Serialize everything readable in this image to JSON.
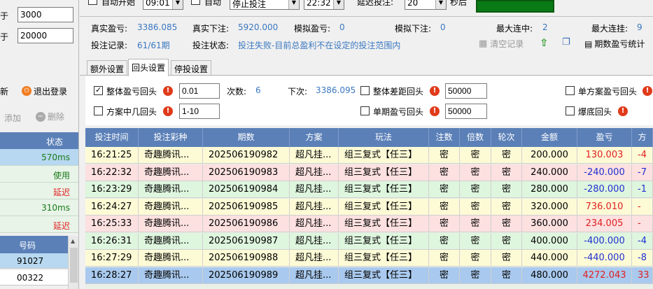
{
  "left": {
    "row1": {
      "label": "大于",
      "value": "3000"
    },
    "row2": {
      "label": "大于",
      "value": "20000"
    },
    "new_label": "新",
    "logout_label": "退出登录",
    "add_label": "添加",
    "delete_label": "删除",
    "status_header": "状态",
    "status_rows": [
      {
        "text": "570ms",
        "color": "#1a7a1a",
        "bg": "#b7d8f0"
      },
      {
        "text": "使用",
        "color": "#1a7a1a",
        "bg": "#e8f4e8"
      },
      {
        "text": "延迟",
        "color": "#e02020",
        "bg": "#e8f4e8"
      },
      {
        "text": "310ms",
        "color": "#1a7a1a",
        "bg": "#e8f4e8"
      },
      {
        "text": "延迟",
        "color": "#e02020",
        "bg": "#e8f4e8"
      }
    ],
    "number_header": "号码",
    "number_rows": [
      {
        "text": "91027",
        "bg": "#b7d8f0"
      },
      {
        "text": "00322",
        "bg": "#ffffff"
      }
    ]
  },
  "topbar": {
    "auto_start_label": "自动开始",
    "start_time": "09:01",
    "auto_label": "自动",
    "mode_select": "停止投注",
    "end_time": "22:32",
    "delay_label": "延迟投注:",
    "delay_value": "20",
    "seconds_label": "秒后"
  },
  "info": {
    "real_profit_label": "真实盈亏:",
    "real_profit_value": "3386.085",
    "real_bet_label": "真实下注:",
    "real_bet_value": "5920.000",
    "sim_profit_label": "模拟盈亏:",
    "sim_profit_value": "0",
    "sim_bet_label": "模拟下注:",
    "sim_bet_value": "0",
    "max_win_label": "最大连中:",
    "max_win_value": "2",
    "max_loss_label": "最大连挂:",
    "max_loss_value": "9",
    "record_label": "投注记录:",
    "record_value": "61/61期",
    "status_label": "投注状态:",
    "status_value": "投注失败-目前总盈利不在设定的投注范围内",
    "clear_label": "清空记录",
    "stats_label": "期数盈亏统计"
  },
  "tabs": [
    {
      "label": "额外设置",
      "active": false
    },
    {
      "label": "回头设置",
      "active": true
    },
    {
      "label": "停投设置",
      "active": false
    }
  ],
  "settings": {
    "overall_rollback_label": "整体盈亏回头",
    "overall_rollback_value": "0.01",
    "times_label": "次数:",
    "times_value": "6",
    "next_label": "下次:",
    "next_value": "3386.095",
    "overall_gap_label": "整体差距回头",
    "overall_gap_value": "50000",
    "single_plan_label": "单方案盈亏回头",
    "plan_rollback_label": "方案中几回头",
    "plan_rollback_value": "1-10",
    "single_period_label": "单期盈亏回头",
    "single_period_value": "50000",
    "bottom_label": "爆底回头"
  },
  "table": {
    "headers": [
      "投注时间",
      "投注彩种",
      "期数",
      "方案",
      "玩法",
      "注数",
      "倍数",
      "轮次",
      "金额",
      "盈亏",
      "方"
    ],
    "rows": [
      {
        "time": "16:21:25",
        "lottery": "奇趣腾讯...",
        "period": "202506190982",
        "plan": "超凡挂...",
        "play": "组三复式【任三】",
        "count": "密",
        "mult": "密",
        "round": "密",
        "amount": "200.000",
        "profit": "130.003",
        "extra": "-4",
        "sign": "pos",
        "bg": "#fdfbd6"
      },
      {
        "time": "16:22:32",
        "lottery": "奇趣腾讯...",
        "period": "202506190983",
        "plan": "超凡挂...",
        "play": "组三复式【任三】",
        "count": "密",
        "mult": "密",
        "round": "密",
        "amount": "240.000",
        "profit": "-240.000",
        "extra": "-7",
        "sign": "neg",
        "bg": "#fde0e0"
      },
      {
        "time": "16:23:29",
        "lottery": "奇趣腾讯...",
        "period": "202506190984",
        "plan": "超凡挂...",
        "play": "组三复式【任三】",
        "count": "密",
        "mult": "密",
        "round": "密",
        "amount": "280.000",
        "profit": "-280.000",
        "extra": "-1",
        "sign": "neg",
        "bg": "#def5de"
      },
      {
        "time": "16:24:27",
        "lottery": "奇趣腾讯...",
        "period": "202506190985",
        "plan": "超凡挂...",
        "play": "组三复式【任三】",
        "count": "密",
        "mult": "密",
        "round": "密",
        "amount": "320.000",
        "profit": "736.010",
        "extra": "-",
        "sign": "pos",
        "bg": "#fdfbd6"
      },
      {
        "time": "16:25:33",
        "lottery": "奇趣腾讯...",
        "period": "202506190986",
        "plan": "超凡挂...",
        "play": "组三复式【任三】",
        "count": "密",
        "mult": "密",
        "round": "密",
        "amount": "360.000",
        "profit": "234.005",
        "extra": "-",
        "sign": "pos",
        "bg": "#fde0e0"
      },
      {
        "time": "16:26:31",
        "lottery": "奇趣腾讯...",
        "period": "202506190987",
        "plan": "超凡挂...",
        "play": "组三复式【任三】",
        "count": "密",
        "mult": "密",
        "round": "密",
        "amount": "400.000",
        "profit": "-400.000",
        "extra": "-4",
        "sign": "neg",
        "bg": "#def5de"
      },
      {
        "time": "16:27:29",
        "lottery": "奇趣腾讯...",
        "period": "202506190988",
        "plan": "超凡挂...",
        "play": "组三复式【任三】",
        "count": "密",
        "mult": "密",
        "round": "密",
        "amount": "440.000",
        "profit": "-440.000",
        "extra": "-8",
        "sign": "neg",
        "bg": "#fdfbd6"
      },
      {
        "time": "16:28:27",
        "lottery": "奇趣腾讯...",
        "period": "202506190989",
        "plan": "超凡挂...",
        "play": "组三复式【任三】",
        "count": "密",
        "mult": "密",
        "round": "密",
        "amount": "480.000",
        "profit": "4272.043",
        "extra": "33",
        "sign": "pos",
        "bg": "#a9c9ee"
      }
    ]
  }
}
